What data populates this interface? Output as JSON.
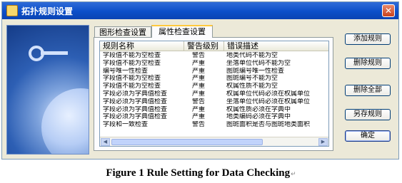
{
  "window": {
    "title": "拓扑规则设置",
    "close_glyph": "✕"
  },
  "tabs": [
    {
      "label": "图形检查设置",
      "active": false
    },
    {
      "label": "属性检查设置",
      "active": true
    }
  ],
  "grid": {
    "columns": [
      "规则名称",
      "警告级别",
      "错误描述"
    ],
    "rows": [
      [
        "字段值不能为空检查",
        "警告",
        "地类代码不能为空"
      ],
      [
        "字段值不能为空检查",
        "严重",
        "坐落单位代码不能为空"
      ],
      [
        "编号唯一性检查",
        "严重",
        "图斑编号唯一性检查"
      ],
      [
        "字段值不能为空检查",
        "严重",
        "图斑编号不能为空"
      ],
      [
        "字段值不能为空检查",
        "严重",
        "权属性质不能为空"
      ],
      [
        "字段必须为字典值检查",
        "严重",
        "权属单位代码必须在权属单位"
      ],
      [
        "字段必须为字典值检查",
        "警告",
        "坐落单位代码必须在权属单位"
      ],
      [
        "字段必须为字典值检查",
        "严重",
        "权属性质必须在字典中"
      ],
      [
        "字段必须为字典值检查",
        "严重",
        "地类编码必须在字典中"
      ],
      [
        "字段和一致检查",
        "警告",
        "图斑面积是否与图斑地类面积"
      ]
    ]
  },
  "buttons": {
    "add": "添加规则",
    "delete": "删除规则",
    "delete_all": "删除全部",
    "save_as": "另存规则",
    "ok": "确定"
  },
  "caption": {
    "text": "Figure 1 Rule Setting for Data Checking",
    "mark": "↵"
  }
}
